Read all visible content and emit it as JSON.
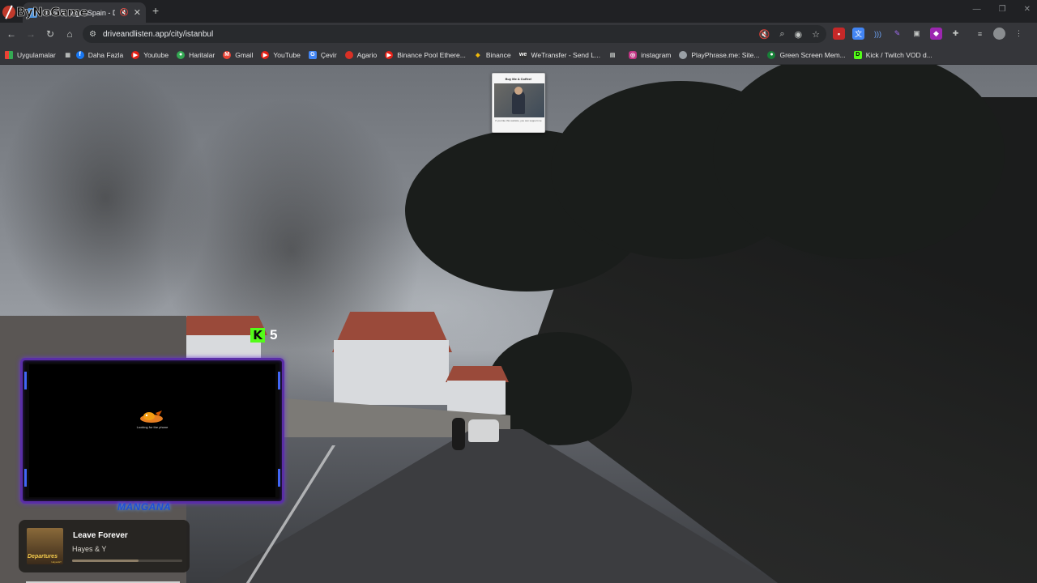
{
  "window": {
    "brand": "ByNoGame",
    "tab_title": "Drive in Vigo, Spain - Drive",
    "controls": [
      "—",
      "❐",
      "✕"
    ]
  },
  "toolbar": {
    "url": "driveandlisten.app/city/istanbul"
  },
  "bookmarks": [
    {
      "label": "Uygulamalar",
      "icon": "apps-grid-icon",
      "color": "#ea4335"
    },
    {
      "label": "Daha Fazla",
      "icon": "facebook-icon",
      "color": "#1877f2"
    },
    {
      "label": "Youtube",
      "icon": "youtube-icon",
      "color": "#e62117"
    },
    {
      "label": "Haritalar",
      "icon": "maps-icon",
      "color": "#34a853"
    },
    {
      "label": "Gmail",
      "icon": "gmail-icon",
      "color": "#ea4335"
    },
    {
      "label": "YouTube",
      "icon": "youtube-icon",
      "color": "#e62117"
    },
    {
      "label": "Çevir",
      "icon": "translate-icon",
      "color": "#4285f4"
    },
    {
      "label": "Agario",
      "icon": "agario-icon",
      "color": "#d93025"
    },
    {
      "label": "Binance Pool Ethere...",
      "icon": "youtube-icon",
      "color": "#e62117"
    },
    {
      "label": "Binance",
      "icon": "binance-icon",
      "color": "#f0b90b"
    },
    {
      "label": "WeTransfer - Send L...",
      "icon": "wetransfer-icon",
      "color": "#333333"
    },
    {
      "label": "instagram",
      "icon": "instagram-icon",
      "color": "#c13584"
    },
    {
      "label": "PlayPhrase.me: Site...",
      "icon": "playphrase-icon",
      "color": "#9aa0a6"
    },
    {
      "label": "Green Screen Mem...",
      "icon": "green-screen-icon",
      "color": "#188038"
    },
    {
      "label": "Kick / Twitch VOD d...",
      "icon": "kick-icon",
      "color": "#53fc18"
    }
  ],
  "overlay": {
    "coffee_title": "Buy Me A Coffee!",
    "coffee_text": "If you like this website, you can support me",
    "kick_viewers": "5",
    "cam_status": "Looking for the phone",
    "cam_nameplate": "MANGANA"
  },
  "now_playing": {
    "title": "Leave Forever",
    "artist": "Hayes & Y",
    "album_art_text": "Departures",
    "album_art_sub": "Hayes&Y",
    "progress": 0.6
  }
}
